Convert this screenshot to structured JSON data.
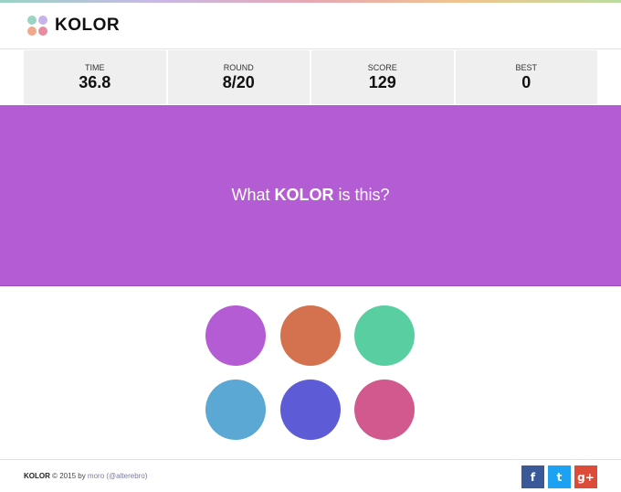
{
  "header": {
    "brand": "KOLOR",
    "logo_colors": [
      "#9bd3c5",
      "#c6b3e8",
      "#f0a98a",
      "#e98ca0"
    ]
  },
  "stats": [
    {
      "label": "TIME",
      "value": "36.8"
    },
    {
      "label": "ROUND",
      "value": "8/20"
    },
    {
      "label": "SCORE",
      "value": "129"
    },
    {
      "label": "BEST",
      "value": "0"
    }
  ],
  "question": {
    "prefix": "What ",
    "brand": "KOLOR",
    "suffix": " is this?",
    "color": "#b45cd3"
  },
  "choices": [
    {
      "color": "#b45cd3"
    },
    {
      "color": "#d4714f"
    },
    {
      "color": "#59cfa1"
    },
    {
      "color": "#5aa8d3"
    },
    {
      "color": "#5d5bd5"
    },
    {
      "color": "#d2598e"
    }
  ],
  "footer": {
    "brand": "KOLOR",
    "copyright": " © 2015 by ",
    "author": "moro",
    "handle": "(@alterebro)"
  },
  "social": [
    {
      "label": "f",
      "name": "facebook",
      "color": "#3b5998"
    },
    {
      "label": "t",
      "name": "twitter",
      "color": "#1da1f2"
    },
    {
      "label": "g+",
      "name": "googleplus",
      "color": "#dd4b39"
    }
  ]
}
